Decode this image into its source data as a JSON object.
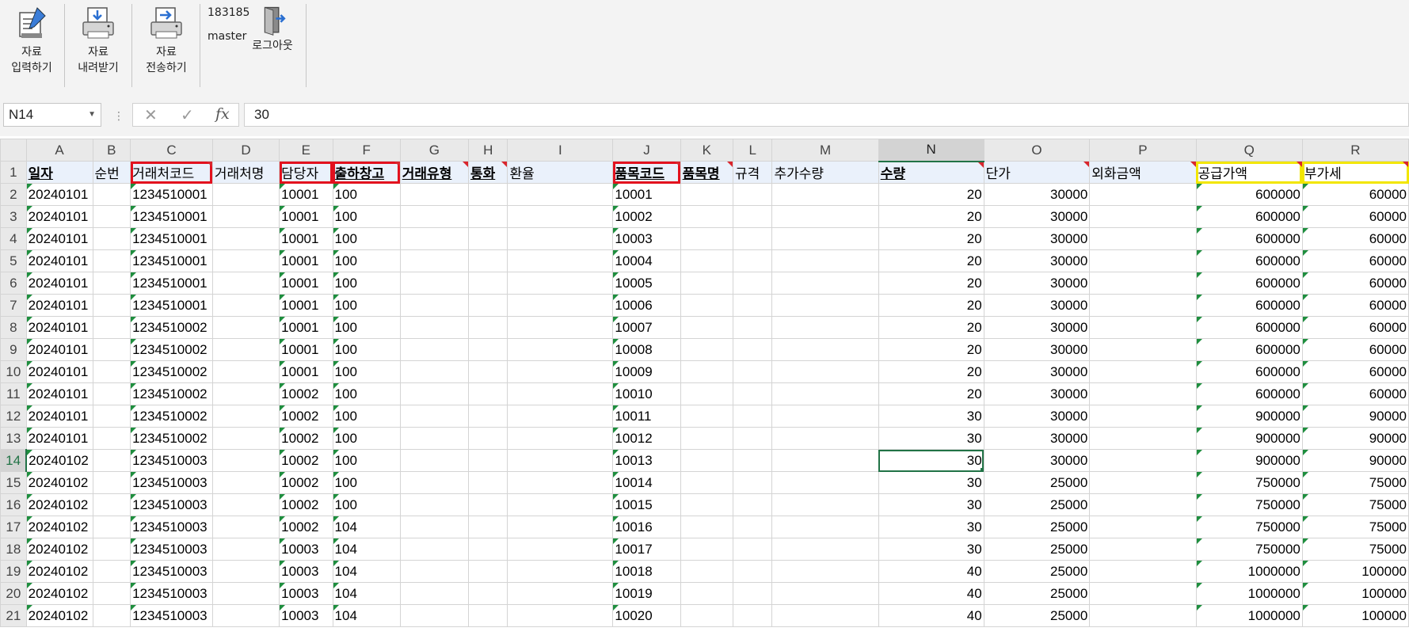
{
  "ribbon": {
    "buttons": [
      {
        "label": "자료\n입력하기",
        "line1": "자료",
        "line2": "입력하기",
        "icon": "document-edit-icon"
      },
      {
        "label": "자료\n내려받기",
        "line1": "자료",
        "line2": "내려받기",
        "icon": "printer-download-icon"
      },
      {
        "label": "자료\n전송하기",
        "line1": "자료",
        "line2": "전송하기",
        "icon": "printer-send-icon"
      }
    ],
    "user_id": "183185",
    "user_name": "master",
    "logout_label": "로그아웃",
    "logout_icon": "door-exit-icon"
  },
  "formula_bar": {
    "name_box": "N14",
    "cancel_icon": "✕",
    "confirm_icon": "✓",
    "fx_label": "fx",
    "value": "30"
  },
  "columns": [
    "A",
    "B",
    "C",
    "D",
    "E",
    "F",
    "G",
    "H",
    "I",
    "J",
    "K",
    "L",
    "M",
    "N",
    "O",
    "P",
    "Q",
    "R"
  ],
  "headers": [
    "일자",
    "순번",
    "거래처코드",
    "거래처명",
    "담당자",
    "출하창고",
    "거래유형",
    "통화",
    "환율",
    "품목코드",
    "품목명",
    "규격",
    "추가수량",
    "수량",
    "단가",
    "외화금액",
    "공급가액",
    "부가세"
  ],
  "required_columns": [
    0,
    5,
    6,
    7,
    9,
    10,
    13
  ],
  "red_boxed_columns": [
    2,
    4,
    5,
    9
  ],
  "yellow_boxed_columns": [
    16,
    17
  ],
  "active_cell": {
    "column": "N",
    "row": 14
  },
  "rows": [
    {
      "n": "2",
      "date": "20240101",
      "client": "1234510001",
      "manager": "10001",
      "warehouse": "100",
      "item": "10001",
      "qty": "20",
      "price": "30000",
      "supply": "600000",
      "vat": "60000"
    },
    {
      "n": "3",
      "date": "20240101",
      "client": "1234510001",
      "manager": "10001",
      "warehouse": "100",
      "item": "10002",
      "qty": "20",
      "price": "30000",
      "supply": "600000",
      "vat": "60000"
    },
    {
      "n": "4",
      "date": "20240101",
      "client": "1234510001",
      "manager": "10001",
      "warehouse": "100",
      "item": "10003",
      "qty": "20",
      "price": "30000",
      "supply": "600000",
      "vat": "60000"
    },
    {
      "n": "5",
      "date": "20240101",
      "client": "1234510001",
      "manager": "10001",
      "warehouse": "100",
      "item": "10004",
      "qty": "20",
      "price": "30000",
      "supply": "600000",
      "vat": "60000"
    },
    {
      "n": "6",
      "date": "20240101",
      "client": "1234510001",
      "manager": "10001",
      "warehouse": "100",
      "item": "10005",
      "qty": "20",
      "price": "30000",
      "supply": "600000",
      "vat": "60000"
    },
    {
      "n": "7",
      "date": "20240101",
      "client": "1234510001",
      "manager": "10001",
      "warehouse": "100",
      "item": "10006",
      "qty": "20",
      "price": "30000",
      "supply": "600000",
      "vat": "60000"
    },
    {
      "n": "8",
      "date": "20240101",
      "client": "1234510002",
      "manager": "10001",
      "warehouse": "100",
      "item": "10007",
      "qty": "20",
      "price": "30000",
      "supply": "600000",
      "vat": "60000"
    },
    {
      "n": "9",
      "date": "20240101",
      "client": "1234510002",
      "manager": "10001",
      "warehouse": "100",
      "item": "10008",
      "qty": "20",
      "price": "30000",
      "supply": "600000",
      "vat": "60000"
    },
    {
      "n": "10",
      "date": "20240101",
      "client": "1234510002",
      "manager": "10001",
      "warehouse": "100",
      "item": "10009",
      "qty": "20",
      "price": "30000",
      "supply": "600000",
      "vat": "60000"
    },
    {
      "n": "11",
      "date": "20240101",
      "client": "1234510002",
      "manager": "10002",
      "warehouse": "100",
      "item": "10010",
      "qty": "20",
      "price": "30000",
      "supply": "600000",
      "vat": "60000"
    },
    {
      "n": "12",
      "date": "20240101",
      "client": "1234510002",
      "manager": "10002",
      "warehouse": "100",
      "item": "10011",
      "qty": "30",
      "price": "30000",
      "supply": "900000",
      "vat": "90000"
    },
    {
      "n": "13",
      "date": "20240101",
      "client": "1234510002",
      "manager": "10002",
      "warehouse": "100",
      "item": "10012",
      "qty": "30",
      "price": "30000",
      "supply": "900000",
      "vat": "90000"
    },
    {
      "n": "14",
      "date": "20240102",
      "client": "1234510003",
      "manager": "10002",
      "warehouse": "100",
      "item": "10013",
      "qty": "30",
      "price": "30000",
      "supply": "900000",
      "vat": "90000"
    },
    {
      "n": "15",
      "date": "20240102",
      "client": "1234510003",
      "manager": "10002",
      "warehouse": "100",
      "item": "10014",
      "qty": "30",
      "price": "25000",
      "supply": "750000",
      "vat": "75000"
    },
    {
      "n": "16",
      "date": "20240102",
      "client": "1234510003",
      "manager": "10002",
      "warehouse": "100",
      "item": "10015",
      "qty": "30",
      "price": "25000",
      "supply": "750000",
      "vat": "75000"
    },
    {
      "n": "17",
      "date": "20240102",
      "client": "1234510003",
      "manager": "10002",
      "warehouse": "104",
      "item": "10016",
      "qty": "30",
      "price": "25000",
      "supply": "750000",
      "vat": "75000"
    },
    {
      "n": "18",
      "date": "20240102",
      "client": "1234510003",
      "manager": "10003",
      "warehouse": "104",
      "item": "10017",
      "qty": "30",
      "price": "25000",
      "supply": "750000",
      "vat": "75000"
    },
    {
      "n": "19",
      "date": "20240102",
      "client": "1234510003",
      "manager": "10003",
      "warehouse": "104",
      "item": "10018",
      "qty": "40",
      "price": "25000",
      "supply": "1000000",
      "vat": "100000"
    },
    {
      "n": "20",
      "date": "20240102",
      "client": "1234510003",
      "manager": "10003",
      "warehouse": "104",
      "item": "10019",
      "qty": "40",
      "price": "25000",
      "supply": "1000000",
      "vat": "100000"
    },
    {
      "n": "21",
      "date": "20240102",
      "client": "1234510003",
      "manager": "10003",
      "warehouse": "104",
      "item": "10020",
      "qty": "40",
      "price": "25000",
      "supply": "1000000",
      "vat": "100000"
    }
  ],
  "colors": {
    "accent": "#217346",
    "required_box": "#e2111e",
    "highlight_box": "#f2e600",
    "comment_marker": "#d9262e",
    "error_marker": "#1e8e3e",
    "header_fill": "#eaf1fb"
  }
}
